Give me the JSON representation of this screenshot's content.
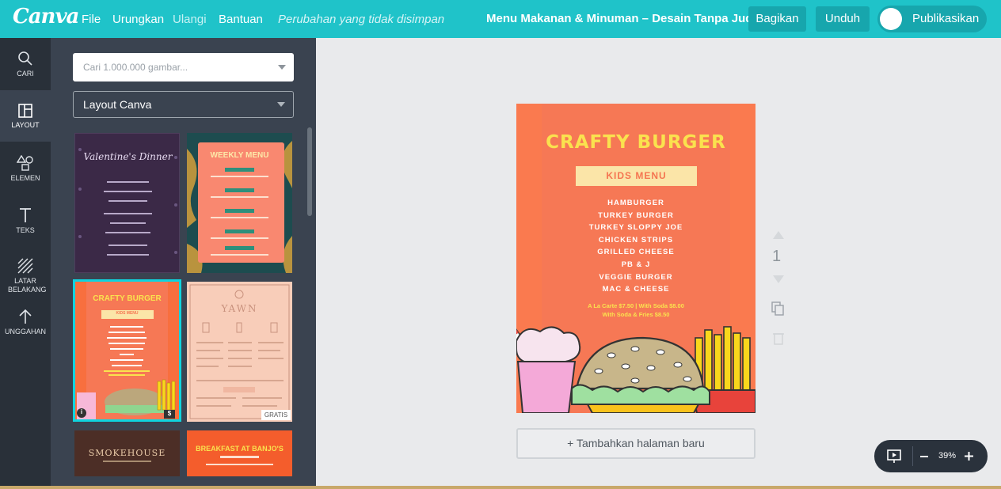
{
  "topbar": {
    "logo": "Canva",
    "menu": [
      "File",
      "Urungkan",
      "Ulangi",
      "Bantuan"
    ],
    "unsaved": "Perubahan yang tidak disimpan",
    "title": "Menu Makanan & Minuman – Desain Tanpa Judul",
    "share": "Bagikan",
    "download": "Unduh",
    "publish": "Publikasikan"
  },
  "rail": [
    {
      "label": "CARI"
    },
    {
      "label": "LAYOUT"
    },
    {
      "label": "ELEMEN"
    },
    {
      "label": "TEKS"
    },
    {
      "label": "LATAR BELAKANG"
    },
    {
      "label": "UNGGAHAN"
    }
  ],
  "panel": {
    "search_placeholder": "Cari 1.000.000 gambar...",
    "layout_select": "Layout Canva",
    "thumbs": {
      "valentine_title": "Valentine's Dinner",
      "weekly_title": "WEEKLY MENU",
      "crafty_title": "CRAFTY BURGER",
      "crafty_sub": "KIDS MENU",
      "yawn_title": "YAWN",
      "yawn_badge": "GRATIS",
      "smoke_title": "SMOKEHOUSE",
      "banjo_title": "BREAKFAST AT BANJO'S",
      "info": "i",
      "dollar": "$"
    }
  },
  "canvas": {
    "title": "CRAFTY BURGER",
    "subtitle": "KIDS MENU",
    "items": [
      "HAMBURGER",
      "TURKEY BURGER",
      "TURKEY SLOPPY JOE",
      "CHICKEN STRIPS",
      "GRILLED CHEESE",
      "PB & J",
      "VEGGIE BURGER",
      "MAC & CHEESE"
    ],
    "price_line1": "A La Carte $7.50 | With Soda $8.00",
    "price_line2": "With Soda & Fries $8.50",
    "page_number": "1",
    "add_page": "+ Tambahkan halaman baru"
  },
  "zoom": {
    "value": "39%"
  },
  "colors": {
    "topbar": "#1fc3c9",
    "rail": "#293039",
    "panel": "#3a4350",
    "menu_bg": "#fa7a4f",
    "menu_title": "#fae24e"
  }
}
